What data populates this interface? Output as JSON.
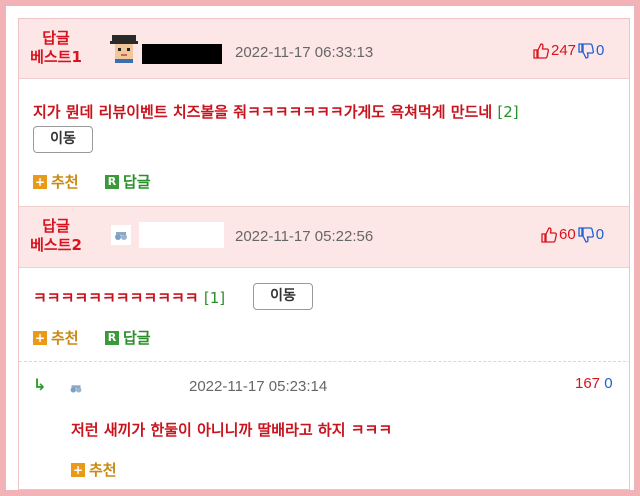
{
  "best1": {
    "label_line1": "답글",
    "label_line2": "베스트1",
    "date": "2022-11-17 06:33:13",
    "up_count": "247",
    "down_count": "0",
    "content": "지가 뭔데 리뷰이벤트 치즈볼을 줘ㅋㅋㅋㅋㅋㅋㅋ가게도 욕쳐먹게 만드네",
    "reply_count": "[2]",
    "move_label": "이동",
    "recommend_label": "추천",
    "reply_label": "답글"
  },
  "best2": {
    "label_line1": "답글",
    "label_line2": "베스트2",
    "date": "2022-11-17 05:22:56",
    "up_count": "60",
    "down_count": "0",
    "content": "ㅋㅋㅋㅋㅋㅋㅋㅋㅋㅋㅋㅋ",
    "reply_count": "[1]",
    "move_label": "이동",
    "recommend_label": "추천",
    "reply_label": "답글"
  },
  "reply": {
    "date": "2022-11-17 05:23:14",
    "up_count": "167",
    "down_count": "0",
    "content": "저런 새끼가 한둘이 아니니까 딸배라고 하지 ㅋㅋㅋ",
    "recommend_label": "추천"
  },
  "icons": {
    "plus_box": "+",
    "r_box": "R",
    "reply_arrow": "↳"
  },
  "colors": {
    "accent_red": "#d8131f",
    "header_bg": "#fde6e6",
    "frame": "#f3b3b6",
    "green": "#2a8f2a",
    "blue": "#1f5fd1"
  }
}
